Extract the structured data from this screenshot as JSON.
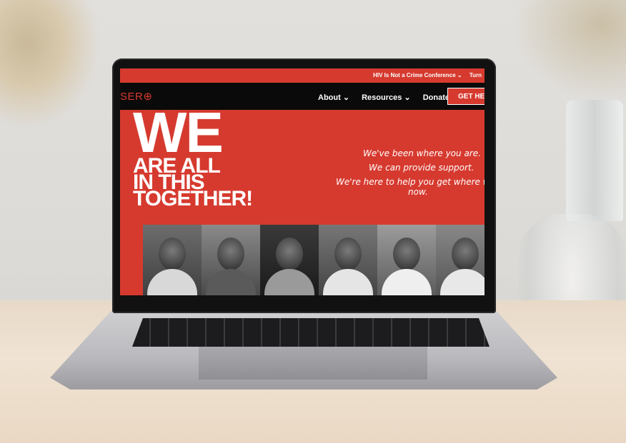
{
  "site": {
    "topbar_links": [
      "HIV Is Not a Crime Conference ⌄",
      "Turn"
    ],
    "logo": "SER⊕",
    "nav_items": [
      "About ⌄",
      "Resources ⌄",
      "Donate"
    ],
    "cta_label": "GET HE",
    "hero": {
      "line1": "WE",
      "line2": "ARE ALL",
      "line3": "IN THIS",
      "line4": "TOGETHER!"
    },
    "taglines": [
      "We've been where you are.",
      "We can provide support.",
      "We're here to help you get where w",
      "now."
    ]
  },
  "colors": {
    "brand_red": "#d63a2f",
    "nav_black": "#0a0a0a"
  }
}
